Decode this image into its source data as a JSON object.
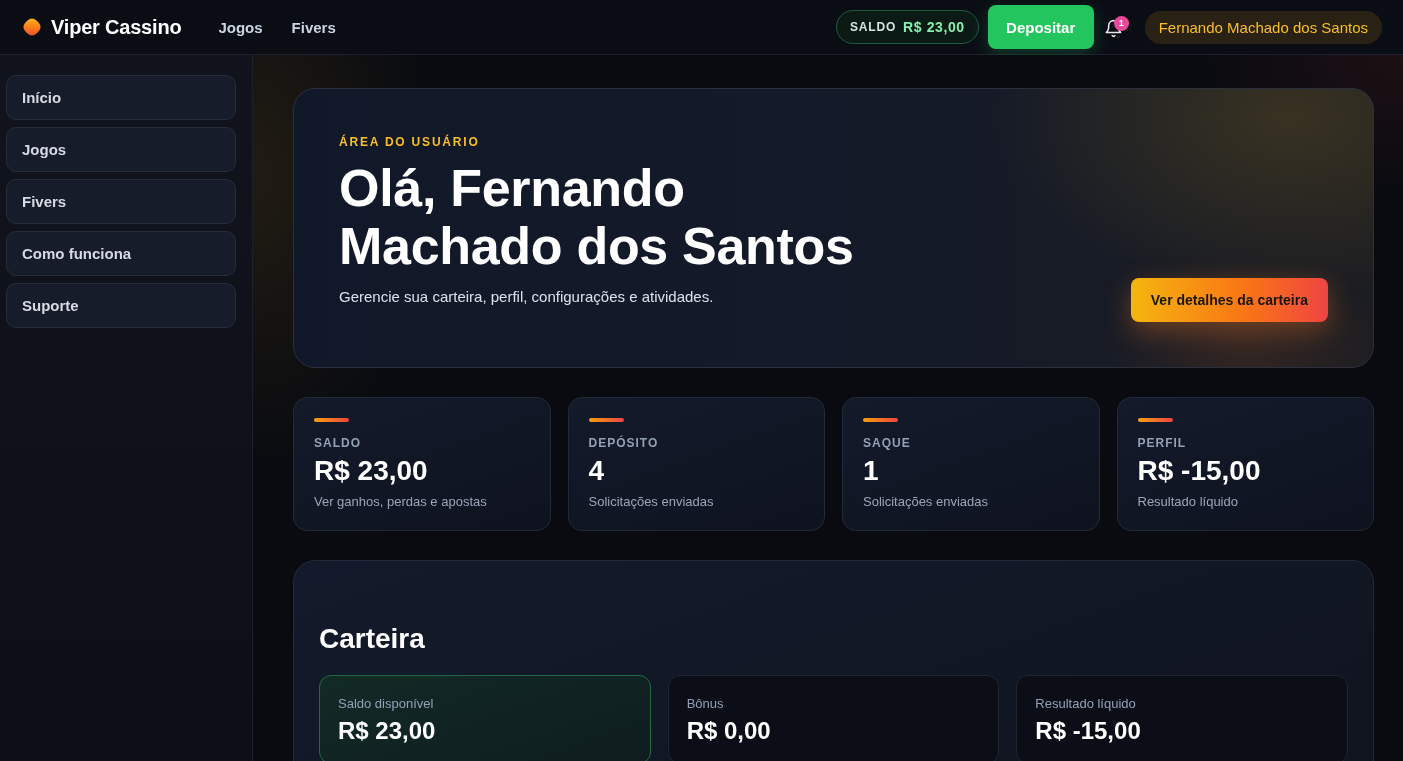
{
  "header": {
    "brand": "Viper Cassino",
    "nav": [
      "Jogos",
      "Fivers"
    ],
    "balance": {
      "label": "SALDO",
      "value": "R$ 23,00"
    },
    "deposit_button": "Depositar",
    "notifications": {
      "count": "1"
    },
    "user": "Fernando Machado dos Santos"
  },
  "sidebar": {
    "items": [
      {
        "label": "Início"
      },
      {
        "label": "Jogos"
      },
      {
        "label": "Fivers"
      },
      {
        "label": "Como funciona"
      },
      {
        "label": "Suporte"
      }
    ]
  },
  "hero": {
    "eyebrow": "ÁREA DO USUÁRIO",
    "title": "Olá, Fernando Machado dos Santos",
    "subtitle": "Gerencie sua carteira, perfil, configurações e atividades.",
    "button": "Ver detalhes da carteira"
  },
  "stats": [
    {
      "label": "SALDO",
      "value": "R$ 23,00",
      "caption": "Ver ganhos, perdas e apostas"
    },
    {
      "label": "DEPÓSITO",
      "value": "4",
      "caption": "Solicitações enviadas"
    },
    {
      "label": "SAQUE",
      "value": "1",
      "caption": "Solicitações enviadas"
    },
    {
      "label": "PERFIL",
      "value": "R$ -15,00",
      "caption": "Resultado líquido"
    }
  ],
  "wallet": {
    "title": "Carteira",
    "cards": [
      {
        "label": "Saldo disponível",
        "value": "R$ 23,00",
        "highlighted": true
      },
      {
        "label": "Bônus",
        "value": "R$ 0,00",
        "highlighted": false
      },
      {
        "label": "Resultado líquido",
        "value": "R$ -15,00",
        "highlighted": false
      }
    ]
  }
}
